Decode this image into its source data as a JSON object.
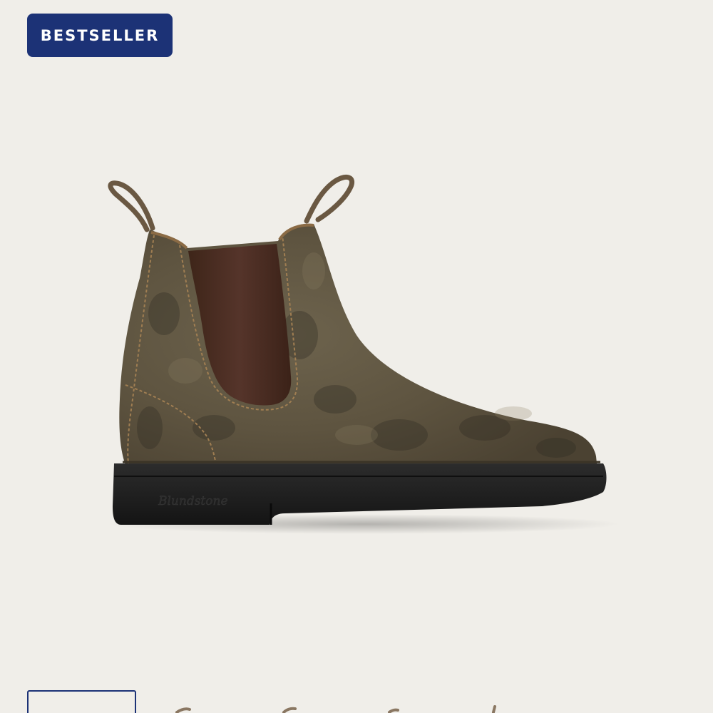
{
  "badge": {
    "label": "BESTSELLER",
    "color": "#1c3276"
  },
  "product": {
    "image_icon": "chelsea-boot-image",
    "boot_color": "#5e5340",
    "elastic_color": "#4a2e22",
    "sole_color": "#1e1e1e",
    "sole_logo": "Blundstone"
  },
  "colors": {
    "background": "#f0eee9"
  }
}
